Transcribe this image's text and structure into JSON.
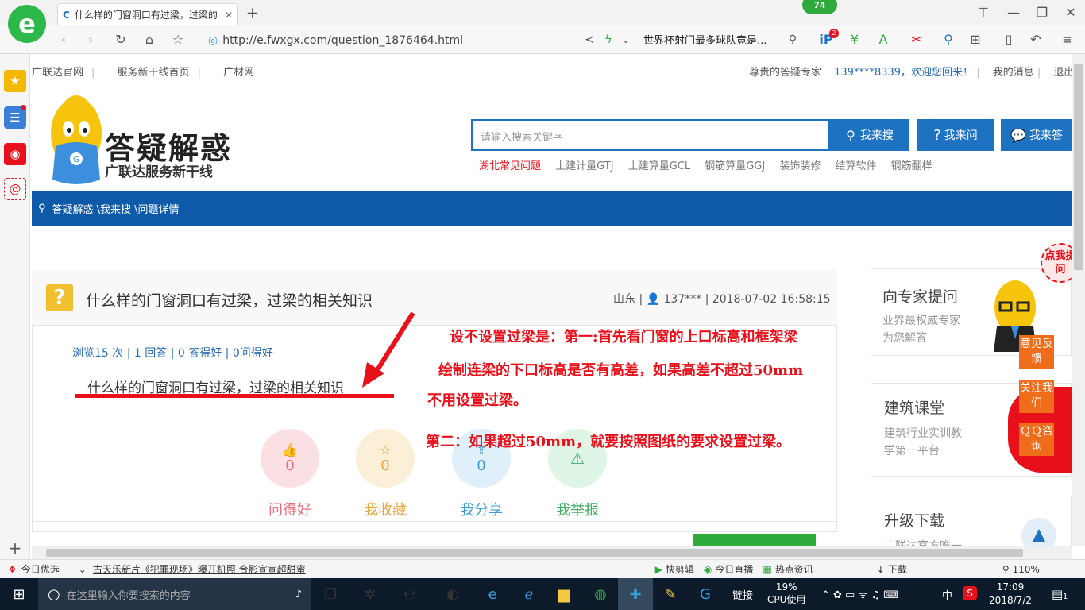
{
  "browser": {
    "tab_title": "什么样的门窗洞口有过梁，过梁的",
    "url": "http://e.fwxgx.com/question_1876464.html",
    "search_text": "世界杯射门最多球队竟是...",
    "badge_count": "74",
    "notif_count": "2"
  },
  "toplinks": {
    "items": [
      "广联达官网",
      "服务新干线首页",
      "广材网"
    ]
  },
  "userlinks": {
    "expert": "尊贵的答疑专家",
    "welcome": "139****8339，欢迎您回来！",
    "messages": "我的消息",
    "logout": "退出"
  },
  "logo": {
    "title": "答疑解惑",
    "subtitle": "广联达服务新干线"
  },
  "search": {
    "placeholder": "请输入搜索关键字",
    "btn_search": "我来搜",
    "btn_ask": "我来问",
    "btn_answer": "我来答"
  },
  "hot": {
    "items": [
      "湖北常见问题",
      "土建计量GTJ",
      "土建算量GCL",
      "钢筋算量GGJ",
      "装饰装修",
      "结算软件",
      "钢筋翻样"
    ]
  },
  "breadcrumb": "答疑解惑 \\我来搜 \\问题详情",
  "question": {
    "title": "什么样的门窗洞口有过梁，过梁的相关知识",
    "meta_region": "山东 |",
    "meta_user": "137*** | 2018-07-02 16:58:15",
    "stats": "浏览15 次 | 1 回答 | 0 答得好 | 0问得好",
    "body": "什么样的门窗洞口有过梁，过梁的相关知识"
  },
  "actions": [
    {
      "label": "问得好",
      "count": "0"
    },
    {
      "label": "我收藏",
      "count": "0"
    },
    {
      "label": "我分享",
      "count": "0"
    },
    {
      "label": "我举报",
      "count": ""
    }
  ],
  "annotation": {
    "line1": "设不设置过梁是：第一:首先看门窗的上口标高和框架梁",
    "line2": "绘制连梁的下口标高是否有高差，如果高差不超过50mm",
    "line3": "不用设置过梁。",
    "line4": "第二：如果超过50mm，就要按照图纸的要求设置过梁。"
  },
  "sidebar": {
    "card1_title": "向专家提问",
    "card1_sub1": "业界最权威专家",
    "card1_sub2": "为您解答",
    "card2_title": "建筑课堂",
    "card2_sub1": "建筑行业实训教",
    "card2_sub2": "学第一平台",
    "card3_title": "升级下载",
    "card3_sub": "广联达官方唯一",
    "float_feedback": "意见反馈",
    "float_follow": "关注我们",
    "float_qq": "ＱＱ咨询",
    "float_click": "点我提问"
  },
  "statusbar": {
    "today": "今日优选",
    "news": "古天乐新片《犯罪现场》曝开机照 合影宣宣超甜蜜",
    "items": [
      "快剪辑",
      "今日直播",
      "热点资讯",
      "下载"
    ],
    "zoom": "110%"
  },
  "taskbar": {
    "search_placeholder": "在这里输入你要搜索的内容",
    "link": "链接",
    "cpu": "19%",
    "cpu_label": "CPU使用",
    "lang": "中",
    "time": "17:09",
    "date": "2018/7/2",
    "notif": "1"
  },
  "colors": {
    "primary": "#1d72c2",
    "nav": "#0f5aa8",
    "annotation": "#e8101a",
    "orange": "#ef6c1a"
  }
}
